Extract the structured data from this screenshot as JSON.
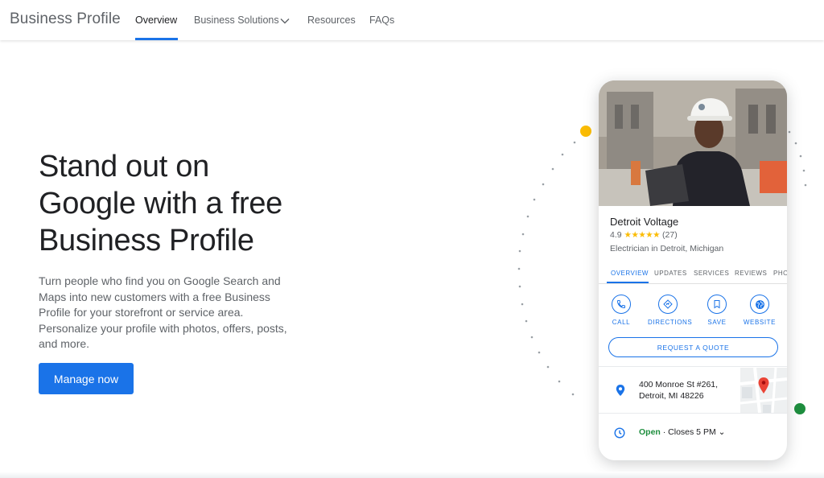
{
  "header": {
    "brand": "Business Profile",
    "nav": [
      {
        "label": "Overview"
      },
      {
        "label": "Business Solutions"
      },
      {
        "label": "Resources"
      },
      {
        "label": "FAQs"
      }
    ],
    "active_nav": "Overview",
    "dropdown_icon": "chevron-down-icon"
  },
  "hero": {
    "headline": [
      "Stand out on",
      "Google with a free",
      "Business Profile"
    ],
    "subtext": "Turn people who find you on Google Search and Maps into new customers with a free Business Profile for your storefront or service area. Personalize your profile with photos, offers, posts, and more.",
    "cta_label": "Manage now"
  },
  "profile_card": {
    "business_name": "Detroit Voltage",
    "rating": "4.9",
    "stars": "★★★★★",
    "review_count": "(27)",
    "category": "Electrician in Detroit, Michigan",
    "tabs": [
      "OVERVIEW",
      "UPDATES",
      "SERVICES",
      "REVIEWS",
      "PHO"
    ],
    "active_tab": "OVERVIEW",
    "actions": [
      {
        "label": "CALL",
        "icon": "phone-icon"
      },
      {
        "label": "DIRECTIONS",
        "icon": "directions-icon"
      },
      {
        "label": "SAVE",
        "icon": "bookmark-icon"
      },
      {
        "label": "WEBSITE",
        "icon": "globe-icon"
      }
    ],
    "quote_button": "REQUEST A QUOTE",
    "address_line1": "400 Monroe St #261,",
    "address_line2": "Detroit, MI 48226",
    "hours_status": "Open",
    "hours_detail": " · Closes 5 PM ⌄"
  },
  "colors": {
    "accent": "#1a73e8",
    "star": "#fbbc04",
    "open": "#1e8e3e",
    "pin": "#ea4335",
    "dot_yellow": "#fbbc04",
    "dot_green": "#1e8e3e"
  }
}
